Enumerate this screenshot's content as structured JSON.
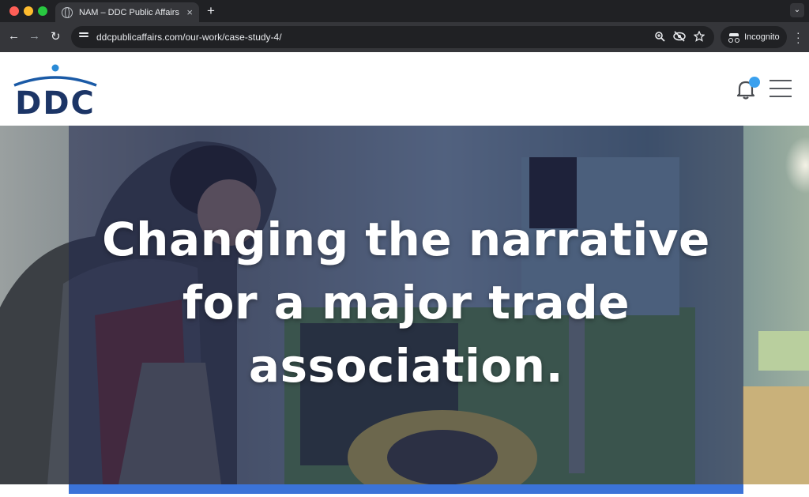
{
  "browser": {
    "tab_title": "NAM – DDC Public Affairs",
    "tab_close": "×",
    "new_tab": "+",
    "url": "ddcpublicaffairs.com/our-work/case-study-4/",
    "incognito_label": "Incognito",
    "icons": [
      "globe-icon",
      "back-icon",
      "forward-icon",
      "reload-icon",
      "site-info-icon",
      "zoom-icon",
      "eye-off-icon",
      "star-icon",
      "incognito-icon",
      "more-icon"
    ]
  },
  "header": {
    "logo_text": "DDC",
    "logo_colors": {
      "arc": "#1a5aa6",
      "dot": "#2a8ad6",
      "letters": "#1c3566"
    },
    "notification_color": "#3aa0ee"
  },
  "hero": {
    "title_lines": [
      "Changing the narrative",
      "for a major trade",
      "association."
    ],
    "accent_color": "#3b73d8",
    "overlay_color": "#202850"
  }
}
